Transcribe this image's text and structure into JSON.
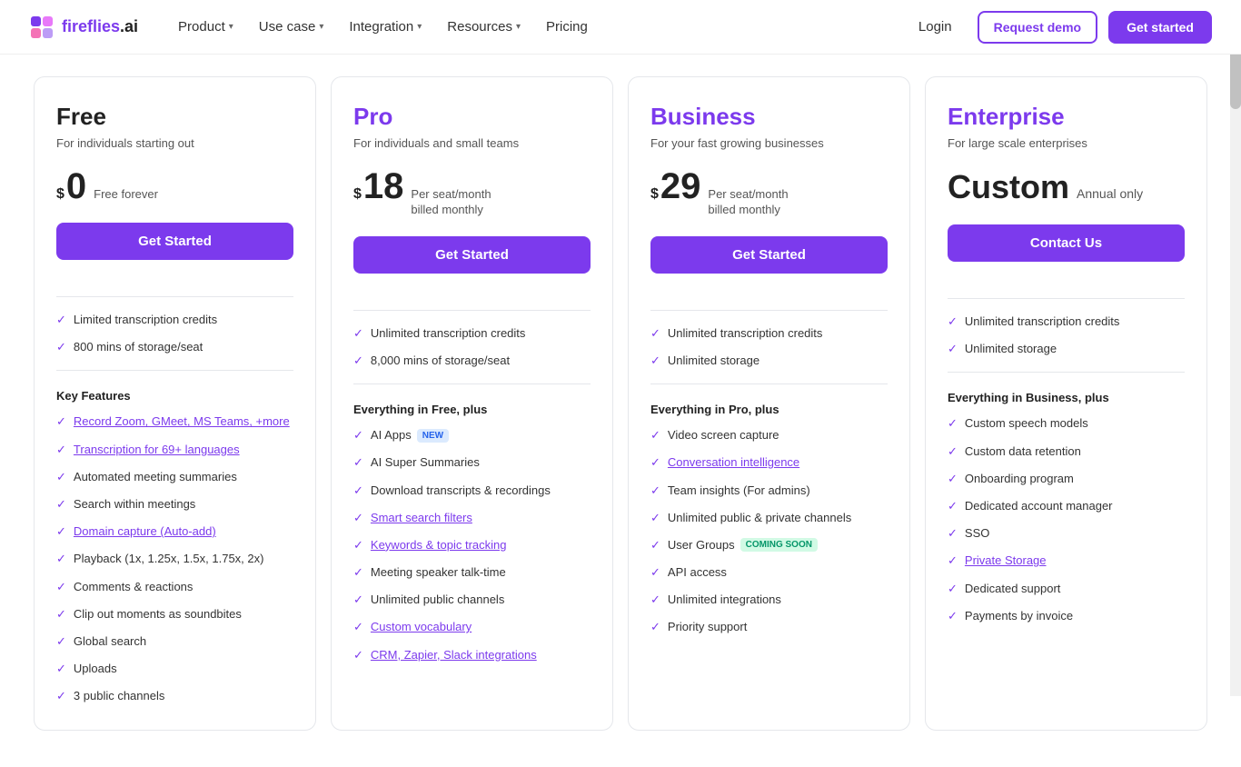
{
  "nav": {
    "logo_text": "fireflies.ai",
    "items": [
      {
        "label": "Product",
        "has_dropdown": true
      },
      {
        "label": "Use case",
        "has_dropdown": true
      },
      {
        "label": "Integration",
        "has_dropdown": true
      },
      {
        "label": "Resources",
        "has_dropdown": true
      }
    ],
    "pricing_label": "Pricing",
    "login_label": "Login",
    "demo_label": "Request demo",
    "get_started_label": "Get started"
  },
  "plans": [
    {
      "id": "free",
      "name": "Free",
      "tagline": "For individuals starting out",
      "price_symbol": "$",
      "price": "0",
      "price_note": "Free forever",
      "price_is_custom": false,
      "cta_label": "Get Started",
      "highlights": [
        {
          "text": "Limited transcription credits",
          "is_link": false
        },
        {
          "text": "800 mins of storage/seat",
          "is_link": false
        }
      ],
      "section_label": "Key Features",
      "features": [
        {
          "text": "Record Zoom, GMeet, MS Teams, +more",
          "is_link": true
        },
        {
          "text": "Transcription for 69+ languages",
          "is_link": true
        },
        {
          "text": "Automated meeting summaries",
          "is_link": false
        },
        {
          "text": "Search within meetings",
          "is_link": false
        },
        {
          "text": "Domain capture (Auto-add)",
          "is_link": true
        },
        {
          "text": "Playback (1x, 1.25x, 1.5x, 1.75x, 2x)",
          "is_link": false
        },
        {
          "text": "Comments & reactions",
          "is_link": false
        },
        {
          "text": "Clip out moments as soundbites",
          "is_link": false
        },
        {
          "text": "Global search",
          "is_link": false
        },
        {
          "text": "Uploads",
          "is_link": false
        },
        {
          "text": "3 public channels",
          "is_link": false
        }
      ]
    },
    {
      "id": "pro",
      "name": "Pro",
      "tagline": "For individuals and small teams",
      "price_symbol": "$",
      "price": "18",
      "price_note": "Per seat/month billed monthly",
      "price_is_custom": false,
      "cta_label": "Get Started",
      "highlights": [
        {
          "text": "Unlimited transcription credits",
          "is_link": false
        },
        {
          "text": "8,000 mins of storage/seat",
          "is_link": false
        }
      ],
      "section_label": "Everything in Free, plus",
      "features": [
        {
          "text": "AI Apps",
          "badge": "NEW",
          "is_link": false
        },
        {
          "text": "AI Super Summaries",
          "is_link": false
        },
        {
          "text": "Download transcripts & recordings",
          "is_link": false
        },
        {
          "text": "Smart search filters",
          "is_link": true
        },
        {
          "text": "Keywords & topic tracking",
          "is_link": true
        },
        {
          "text": "Meeting speaker talk-time",
          "is_link": false
        },
        {
          "text": "Unlimited public channels",
          "is_link": false
        },
        {
          "text": "Custom vocabulary",
          "is_link": true
        },
        {
          "text": "CRM, Zapier, Slack integrations",
          "is_link": true
        }
      ]
    },
    {
      "id": "business",
      "name": "Business",
      "tagline": "For your fast growing businesses",
      "price_symbol": "$",
      "price": "29",
      "price_note": "Per seat/month billed monthly",
      "price_is_custom": false,
      "cta_label": "Get Started",
      "highlights": [
        {
          "text": "Unlimited transcription credits",
          "is_link": false
        },
        {
          "text": "Unlimited storage",
          "is_link": false
        }
      ],
      "section_label": "Everything in Pro, plus",
      "features": [
        {
          "text": "Video screen capture",
          "is_link": false
        },
        {
          "text": "Conversation intelligence",
          "is_link": true
        },
        {
          "text": "Team insights (For admins)",
          "is_link": false
        },
        {
          "text": "Unlimited public & private channels",
          "is_link": false
        },
        {
          "text": "User Groups",
          "badge": "COMING SOON",
          "badge_type": "soon",
          "is_link": false
        },
        {
          "text": "API access",
          "is_link": false
        },
        {
          "text": "Unlimited integrations",
          "is_link": false
        },
        {
          "text": "Priority support",
          "is_link": false
        }
      ]
    },
    {
      "id": "enterprise",
      "name": "Enterprise",
      "tagline": "For large scale enterprises",
      "price_custom": "Custom",
      "price_annual": "Annual only",
      "price_is_custom": true,
      "cta_label": "Contact Us",
      "highlights": [
        {
          "text": "Unlimited transcription credits",
          "is_link": false
        },
        {
          "text": "Unlimited storage",
          "is_link": false
        }
      ],
      "section_label": "Everything in Business, plus",
      "features": [
        {
          "text": "Custom speech models",
          "is_link": false
        },
        {
          "text": "Custom data retention",
          "is_link": false
        },
        {
          "text": "Onboarding program",
          "is_link": false
        },
        {
          "text": "Dedicated account manager",
          "is_link": false
        },
        {
          "text": "SSO",
          "is_link": false
        },
        {
          "text": "Private Storage",
          "is_link": true
        },
        {
          "text": "Dedicated support",
          "is_link": false
        },
        {
          "text": "Payments by invoice",
          "is_link": false
        }
      ]
    }
  ]
}
